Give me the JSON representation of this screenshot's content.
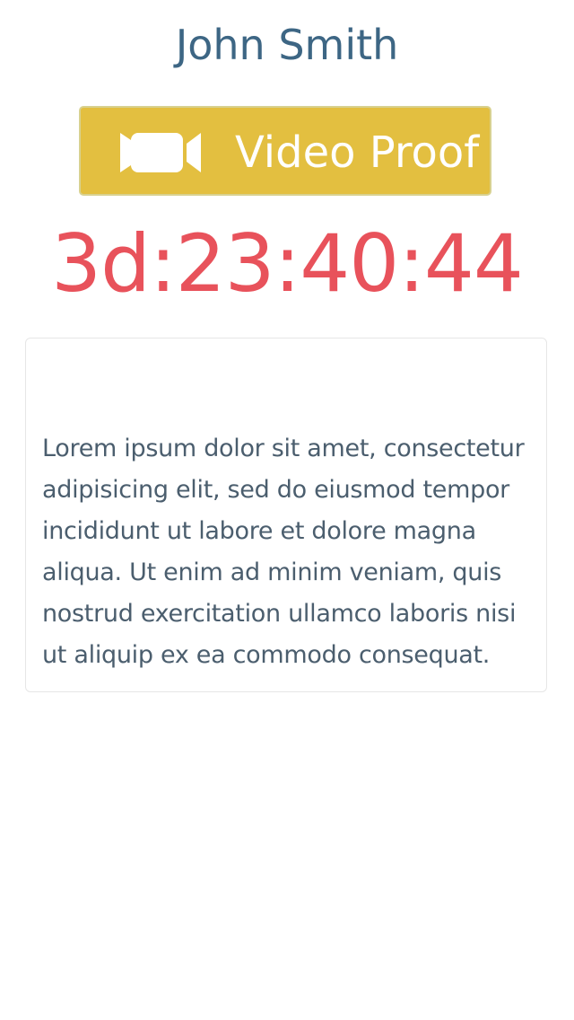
{
  "header": {
    "name": "John Smith"
  },
  "video_button": {
    "label": "Video Proof",
    "icon": "video-camera-icon",
    "background_color": "#e3bf40"
  },
  "countdown": {
    "value": "3d:23:40:44",
    "color": "#e8525b"
  },
  "card": {
    "text": "Lorem ipsum dolor sit amet, consectetur adipisicing elit, sed do eiusmod tempor incididunt ut labore et dolore magna aliqua. Ut enim ad minim veniam, quis nostrud exercitation ullamco laboris nisi ut aliquip ex ea commodo consequat."
  },
  "colors": {
    "title": "#3d6684",
    "body_text": "#4b5e6e"
  }
}
